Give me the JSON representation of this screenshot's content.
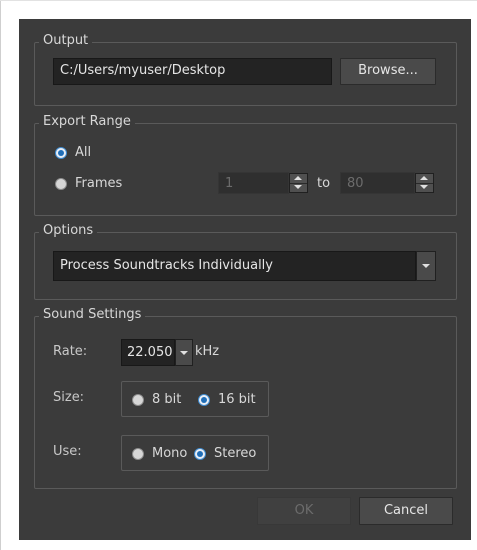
{
  "output": {
    "legend": "Output",
    "path_value": "C:/Users/myuser/Desktop",
    "browse_label": "Browse..."
  },
  "export_range": {
    "legend": "Export Range",
    "all_label": "All",
    "all_selected": true,
    "frames_label": "Frames",
    "frames_selected": false,
    "from_value": "1",
    "to_label": "to",
    "to_value": "80"
  },
  "options": {
    "legend": "Options",
    "selected_value": "Process Soundtracks Individually"
  },
  "sound_settings": {
    "legend": "Sound Settings",
    "rate_label": "Rate:",
    "rate_value": "22.050",
    "rate_unit": "kHz",
    "size_label": "Size:",
    "size_options": [
      {
        "label": "8 bit",
        "selected": false
      },
      {
        "label": "16 bit",
        "selected": true
      }
    ],
    "use_label": "Use:",
    "use_options": [
      {
        "label": "Mono",
        "selected": false
      },
      {
        "label": "Stereo",
        "selected": true
      }
    ]
  },
  "footer": {
    "ok_label": "OK",
    "ok_enabled": false,
    "cancel_label": "Cancel"
  },
  "colors": {
    "dialog_bg": "#3b3b3b",
    "field_bg": "#232323",
    "radio_selected": "#1f6eb8"
  }
}
